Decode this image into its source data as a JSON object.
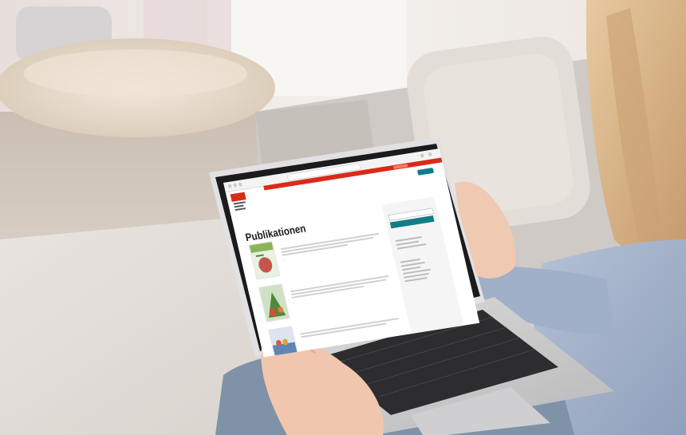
{
  "laptop_screen": {
    "website_heading": "Publikationen",
    "url": "",
    "nav_items": [
      "",
      "",
      "",
      ""
    ],
    "publications": [
      {
        "title": ""
      },
      {
        "title": ""
      },
      {
        "title": ""
      }
    ],
    "sidebar_title": "",
    "sidebar_sections": [
      "",
      ""
    ]
  },
  "colors": {
    "site_accent_red": "#d92b1a",
    "site_accent_teal": "#137d86",
    "wall_background": "#e9e4df",
    "sofa_gray": "#cfcac6",
    "sweater_blue": "#a8b8cf",
    "hair_blonde": "#d9b58a"
  }
}
